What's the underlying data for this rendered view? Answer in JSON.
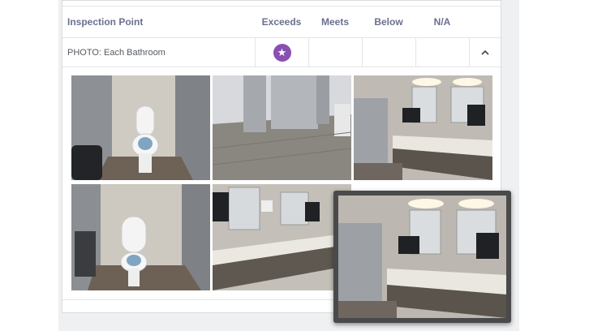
{
  "table": {
    "headers": {
      "inspection_point": "Inspection Point",
      "exceeds": "Exceeds",
      "meets": "Meets",
      "below": "Below",
      "na": "N/A"
    },
    "row": {
      "label": "PHOTO: Each Bathroom",
      "rating": "Exceeds",
      "rating_icon": "star-icon",
      "expand_icon": "chevron-up-icon"
    }
  },
  "colors": {
    "accent": "#8a4fb2",
    "header_text": "#6b6f8f"
  },
  "photos": [
    {
      "subject": "toilet-stall"
    },
    {
      "subject": "hallway-stalls"
    },
    {
      "subject": "sink-counter"
    },
    {
      "subject": "toilet-stall"
    },
    {
      "subject": "sink-counter"
    }
  ],
  "preview": {
    "subject": "sink-counter"
  }
}
